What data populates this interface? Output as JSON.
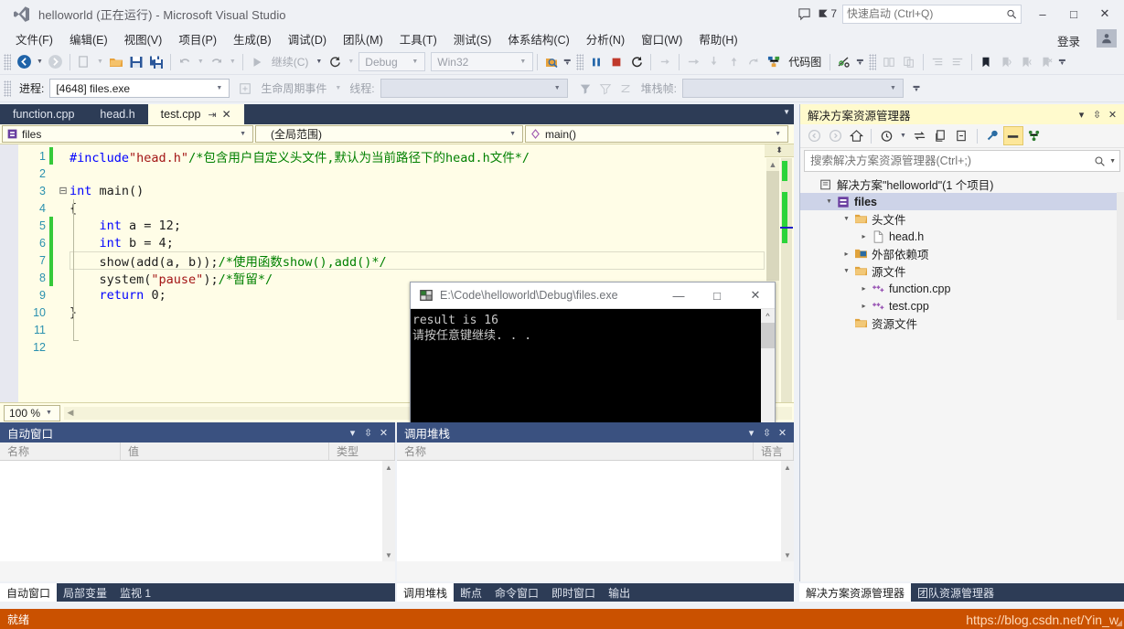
{
  "window": {
    "title": "helloworld (正在运行) - Microsoft Visual Studio",
    "logo_icon": "vs-logo-icon",
    "feedback_icon": "feedback-icon",
    "notify_icon": "notification-flag-icon",
    "notify_count": "7",
    "search_placeholder": "快速启动 (Ctrl+Q)",
    "search_icon": "search-icon",
    "minimize": "–",
    "maximize": "□",
    "close": "✕",
    "signin": "登录",
    "account_icon": "account-avatar-icon"
  },
  "menu": [
    {
      "label": "文件(F)"
    },
    {
      "label": "编辑(E)"
    },
    {
      "label": "视图(V)"
    },
    {
      "label": "项目(P)"
    },
    {
      "label": "生成(B)"
    },
    {
      "label": "调试(D)"
    },
    {
      "label": "团队(M)"
    },
    {
      "label": "工具(T)"
    },
    {
      "label": "测试(S)"
    },
    {
      "label": "体系结构(C)"
    },
    {
      "label": "分析(N)"
    },
    {
      "label": "窗口(W)"
    },
    {
      "label": "帮助(H)"
    }
  ],
  "toolbar": {
    "back_icon": "navigate-back-icon",
    "forward_icon": "navigate-forward-icon",
    "new_project_icon": "new-project-icon",
    "open_file_icon": "open-file-icon",
    "save_icon": "save-icon",
    "save_all_icon": "save-all-icon",
    "undo_icon": "undo-icon",
    "redo_icon": "redo-icon",
    "continue_icon": "continue-play-icon",
    "continue_label": "继续(C)",
    "restart_icon": "restart-icon",
    "config_value": "Debug",
    "platform_value": "Win32",
    "find_icon": "find-in-files-icon",
    "pause_icon": "pause-icon",
    "stop_icon": "stop-icon",
    "restart2_icon": "restart-debug-icon",
    "showstmt_icon": "show-next-statement-icon",
    "stepover_icon": "step-over-icon",
    "stepinto_icon": "step-into-icon",
    "stepout_icon": "step-out-icon",
    "stepcursor_icon": "run-to-cursor-icon",
    "codemap_icon": "code-map-icon",
    "codemap_label": "代码图",
    "intellitrace_icon": "intellitrace-icon",
    "compare_icon": "compare-icon",
    "compare2_icon": "compare-alt-icon",
    "indent_icon": "indent-icon",
    "outdent_icon": "outdent-icon",
    "bookmark_icon": "bookmark-icon",
    "bookmark_prev_icon": "bookmark-prev-icon",
    "bookmark_next_icon": "bookmark-next-icon",
    "bookmark_clear_icon": "bookmark-clear-icon",
    "overflow_icon": "toolbar-overflow-icon"
  },
  "debugbar": {
    "process_label": "进程:",
    "process_value": "[4648] files.exe",
    "lifecycle_icon": "lifecycle-events-icon",
    "lifecycle_label": "生命周期事件",
    "thread_label": "线程:",
    "thread_value": "",
    "filter_icon": "filter-icon",
    "filter2_icon": "filter-clear-icon",
    "filter3_icon": "no-filter-icon",
    "stackframe_label": "堆栈帧:",
    "stackframe_value": "",
    "overflow_icon": "toolbar-overflow-icon"
  },
  "editor": {
    "tabs": [
      {
        "label": "function.cpp",
        "active": false
      },
      {
        "label": "head.h",
        "active": false
      },
      {
        "label": "test.cpp",
        "active": true
      }
    ],
    "pin_icon": "pin-icon",
    "close_icon": "close-icon",
    "tabs_dropdown_icon": "chevron-down-icon",
    "scope_icon": "project-icon",
    "scope_value": "files",
    "member_scope_value": "(全局范围)",
    "member_icon": "method-icon",
    "member_value": "main()",
    "zoom_value": "100 %",
    "lines": [
      {
        "n": "1",
        "changed": true,
        "glyph": "",
        "current": false,
        "tokens": [
          [
            "pp",
            "#include"
          ],
          [
            "str",
            "\"head.h\""
          ],
          [
            "cmt",
            "/*包含用户自定义头文件,默认为当前路径下的head.h文件*/"
          ]
        ]
      },
      {
        "n": "2",
        "changed": false,
        "glyph": "",
        "current": false,
        "tokens": [
          [
            "plain",
            ""
          ]
        ]
      },
      {
        "n": "3",
        "changed": false,
        "glyph": "⊟",
        "current": false,
        "tokens": [
          [
            "kw",
            "int"
          ],
          [
            "plain",
            " "
          ],
          [
            "fn",
            "main"
          ],
          [
            "plain",
            "()"
          ]
        ]
      },
      {
        "n": "4",
        "changed": false,
        "glyph": "",
        "current": false,
        "tokens": [
          [
            "plain",
            "{"
          ]
        ]
      },
      {
        "n": "5",
        "changed": true,
        "glyph": "",
        "current": false,
        "tokens": [
          [
            "plain",
            "    "
          ],
          [
            "kw",
            "int"
          ],
          [
            "plain",
            " a = "
          ],
          [
            "num",
            "12"
          ],
          [
            "plain",
            ";"
          ]
        ]
      },
      {
        "n": "6",
        "changed": true,
        "glyph": "",
        "current": false,
        "tokens": [
          [
            "plain",
            "    "
          ],
          [
            "kw",
            "int"
          ],
          [
            "plain",
            " b = "
          ],
          [
            "num",
            "4"
          ],
          [
            "plain",
            ";"
          ]
        ]
      },
      {
        "n": "7",
        "changed": true,
        "glyph": "",
        "current": true,
        "tokens": [
          [
            "plain",
            "    show(add(a, b));"
          ],
          [
            "cmt",
            "/*使用函数show(),add()*/"
          ]
        ]
      },
      {
        "n": "8",
        "changed": true,
        "glyph": "",
        "current": false,
        "tokens": [
          [
            "plain",
            "    system("
          ],
          [
            "str",
            "\"pause\""
          ],
          [
            "plain",
            ");"
          ],
          [
            "cmt",
            "/*暂留*/"
          ]
        ]
      },
      {
        "n": "9",
        "changed": false,
        "glyph": "",
        "current": false,
        "tokens": [
          [
            "plain",
            "    "
          ],
          [
            "kw",
            "return"
          ],
          [
            "plain",
            " "
          ],
          [
            "num",
            "0"
          ],
          [
            "plain",
            ";"
          ]
        ]
      },
      {
        "n": "10",
        "changed": false,
        "glyph": "",
        "current": false,
        "tokens": [
          [
            "plain",
            "}"
          ]
        ]
      },
      {
        "n": "11",
        "changed": false,
        "glyph": "",
        "current": false,
        "tokens": [
          [
            "plain",
            ""
          ]
        ]
      },
      {
        "n": "12",
        "changed": false,
        "glyph": "",
        "current": false,
        "tokens": [
          [
            "plain",
            ""
          ]
        ]
      }
    ]
  },
  "console": {
    "icon": "console-window-icon",
    "title": "E:\\Code\\helloworld\\Debug\\files.exe",
    "minimize": "—",
    "maximize": "□",
    "close": "✕",
    "output": "result is 16\n请按任意键继续. . .",
    "scroll_up_icon": "scroll-up-icon",
    "scroll_down_icon": "scroll-down-icon"
  },
  "solution_explorer": {
    "title": "解决方案资源管理器",
    "dropdown_icon": "chevron-down-icon",
    "pin_icon": "pin-icon",
    "close_icon": "close-icon",
    "toolbar": {
      "back_icon": "back-icon",
      "forward_icon": "forward-icon",
      "home_icon": "home-icon",
      "pending_changes_icon": "pending-changes-icon",
      "sync_icon": "sync-with-active-document-icon",
      "refresh_icon": "refresh-icon",
      "collapse_icon": "collapse-all-icon",
      "properties_icon": "properties-wrench-icon",
      "show_all_icon": "show-all-files-icon",
      "preview_icon": "preview-selected-items-icon"
    },
    "search_placeholder": "搜索解决方案资源管理器(Ctrl+;)",
    "search_icon": "search-icon",
    "search_dropdown_icon": "chevron-down-icon",
    "tree": [
      {
        "indent": 0,
        "arrow": "",
        "icon": "solution-icon",
        "label": "解决方案\"helloworld\"(1 个项目)",
        "bold": false,
        "selected": false
      },
      {
        "indent": 1,
        "arrow": "▴",
        "icon": "project-icon",
        "label": "files",
        "bold": true,
        "selected": true
      },
      {
        "indent": 2,
        "arrow": "▴",
        "icon": "folder-icon",
        "label": "头文件",
        "bold": false,
        "selected": false
      },
      {
        "indent": 3,
        "arrow": "▸",
        "icon": "header-file-icon",
        "label": "head.h",
        "bold": false,
        "selected": false
      },
      {
        "indent": 2,
        "arrow": "▸",
        "icon": "ext-deps-icon",
        "label": "外部依赖项",
        "bold": false,
        "selected": false
      },
      {
        "indent": 2,
        "arrow": "▴",
        "icon": "folder-icon",
        "label": "源文件",
        "bold": false,
        "selected": false
      },
      {
        "indent": 3,
        "arrow": "▸",
        "icon": "cpp-file-icon",
        "label": "function.cpp",
        "bold": false,
        "selected": false
      },
      {
        "indent": 3,
        "arrow": "▸",
        "icon": "cpp-file-icon",
        "label": "test.cpp",
        "bold": false,
        "selected": false
      },
      {
        "indent": 2,
        "arrow": "",
        "icon": "folder-icon",
        "label": "资源文件",
        "bold": false,
        "selected": false
      }
    ],
    "tabs": [
      {
        "label": "解决方案资源管理器",
        "active": true
      },
      {
        "label": "团队资源管理器",
        "active": false
      }
    ]
  },
  "autos_panel": {
    "title": "自动窗口",
    "dropdown_icon": "chevron-down-icon",
    "pin_icon": "pin-icon",
    "close_icon": "close-icon",
    "columns": [
      "名称",
      "值",
      "类型"
    ],
    "rows": [],
    "tabs": [
      {
        "label": "自动窗口",
        "active": true
      },
      {
        "label": "局部变量",
        "active": false
      },
      {
        "label": "监视 1",
        "active": false
      }
    ]
  },
  "callstack_panel": {
    "title": "调用堆栈",
    "dropdown_icon": "chevron-down-icon",
    "pin_icon": "pin-icon",
    "close_icon": "close-icon",
    "columns": [
      "名称",
      "语言"
    ],
    "rows": [],
    "tabs": [
      {
        "label": "调用堆栈",
        "active": true
      },
      {
        "label": "断点",
        "active": false
      },
      {
        "label": "命令窗口",
        "active": false
      },
      {
        "label": "即时窗口",
        "active": false
      },
      {
        "label": "输出",
        "active": false
      }
    ]
  },
  "statusbar": {
    "text": "就绪",
    "watermark": "https://blog.csdn.net/Yin_w"
  },
  "colors": {
    "accent_status": "#ca5100",
    "title_panel": "#fffacd",
    "editor_bg": "#fffde7",
    "tab_strip": "#2d3c56",
    "panel_header": "#3a5180",
    "changed_line": "#36c93a"
  }
}
